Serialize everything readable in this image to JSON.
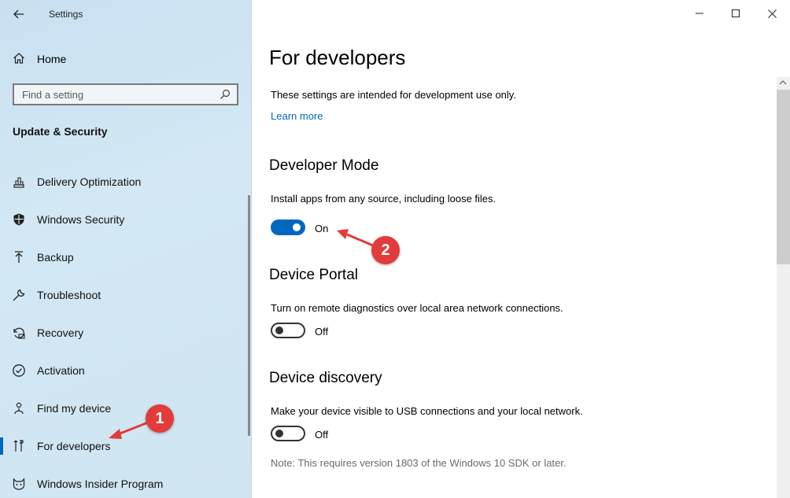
{
  "app": {
    "title": "Settings"
  },
  "sidebar": {
    "home_label": "Home",
    "search_placeholder": "Find a setting",
    "section_title": "Update & Security",
    "items": [
      {
        "label": "Delivery Optimization",
        "icon": "delivery-optimization-icon"
      },
      {
        "label": "Windows Security",
        "icon": "shield-icon"
      },
      {
        "label": "Backup",
        "icon": "backup-arrow-icon"
      },
      {
        "label": "Troubleshoot",
        "icon": "wrench-icon"
      },
      {
        "label": "Recovery",
        "icon": "recovery-icon"
      },
      {
        "label": "Activation",
        "icon": "check-circle-icon"
      },
      {
        "label": "Find my device",
        "icon": "person-location-icon"
      },
      {
        "label": "For developers",
        "icon": "developer-tools-icon",
        "active": true
      },
      {
        "label": "Windows Insider Program",
        "icon": "insider-cat-icon"
      }
    ]
  },
  "main": {
    "title": "For developers",
    "intro": "These settings are intended for development use only.",
    "learn_more": "Learn more",
    "sections": [
      {
        "heading": "Developer Mode",
        "description": "Install apps from any source, including loose files.",
        "toggle_state": "on",
        "toggle_label": "On"
      },
      {
        "heading": "Device Portal",
        "description": "Turn on remote diagnostics over local area network connections.",
        "toggle_state": "off",
        "toggle_label": "Off"
      },
      {
        "heading": "Device discovery",
        "description": "Make your device visible to USB connections and your local network.",
        "toggle_state": "off",
        "toggle_label": "Off"
      }
    ],
    "note": "Note: This requires version 1803 of the Windows 10 SDK or later."
  },
  "annotations": {
    "badge_1": "1",
    "badge_2": "2",
    "color": "#e33b3b"
  },
  "colors": {
    "accent": "#0067c0"
  }
}
